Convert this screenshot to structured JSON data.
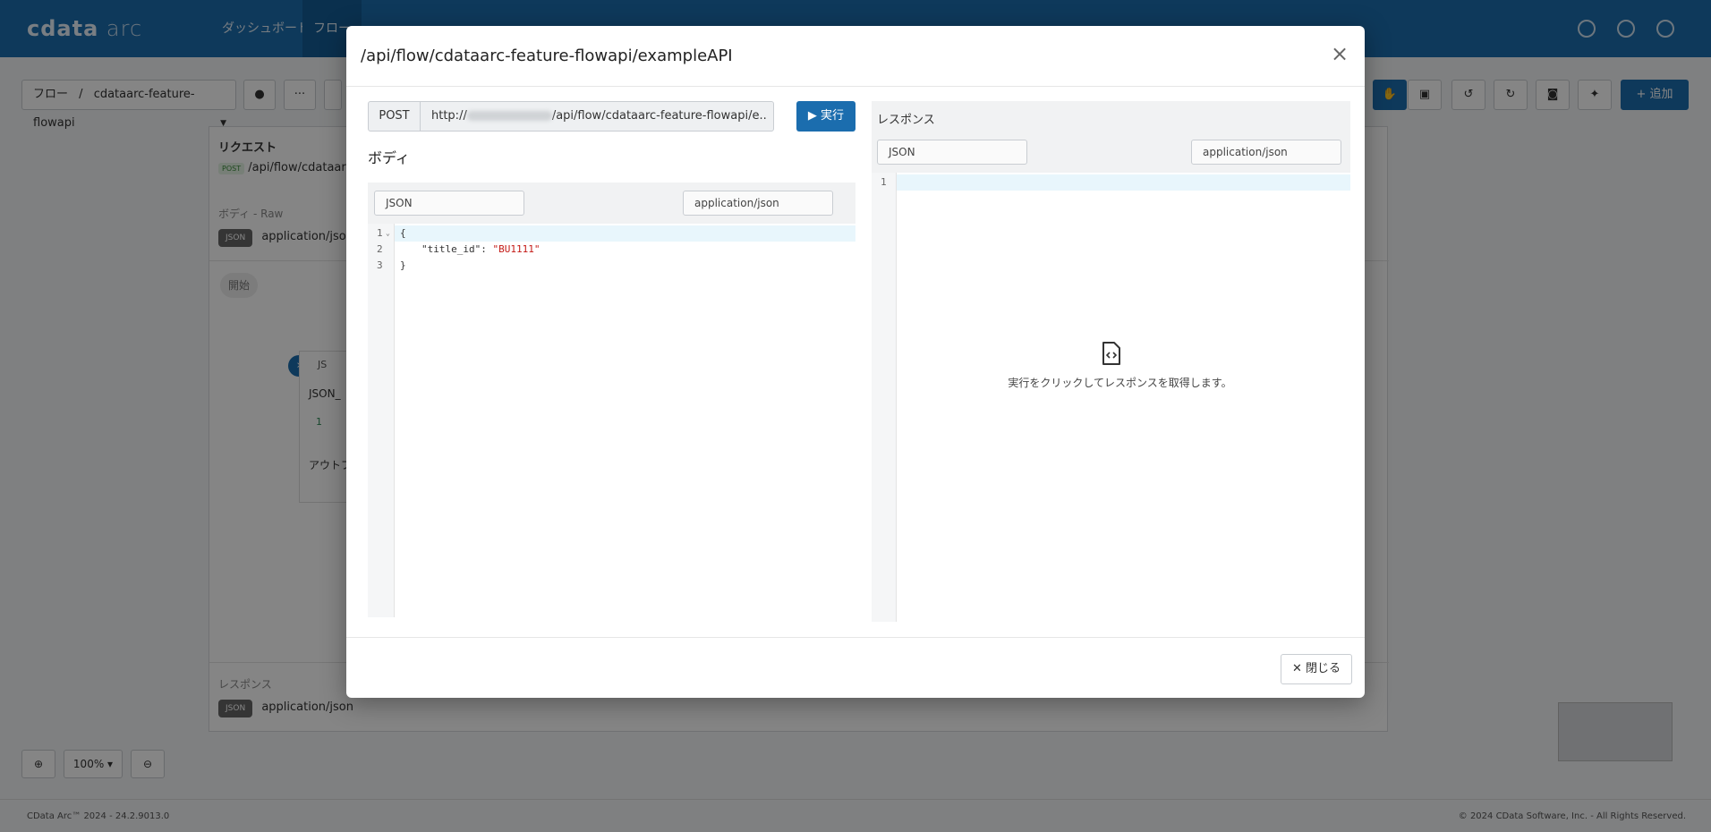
{
  "app": {
    "logo_primary": "cdata",
    "logo_secondary": "arc",
    "nav": [
      {
        "label": "ダッシュボード"
      },
      {
        "label": "フロー"
      }
    ]
  },
  "toolbar": {
    "breadcrumb_root": "フロー",
    "breadcrumb_sep": "/",
    "breadcrumb_current": "cdataarc-feature-flowapi",
    "more_label": "···",
    "add_label": "+ 追加"
  },
  "background": {
    "request_label": "リクエスト",
    "request_method": "POST",
    "request_path": "/api/flow/cdataarc",
    "body_label": "ボディ - Raw",
    "body_format": "JSON",
    "body_content_type": "application/json",
    "start_node": "開始",
    "node_prefix": "JS",
    "node_name": "JSON_",
    "node_count": "1",
    "output_label": "アウトプ",
    "response_label": "レスポンス",
    "response_format": "JSON",
    "response_content_type": "application/json",
    "zoom": "100%"
  },
  "modal": {
    "title": "/api/flow/cdataarc-feature-flowapi/exampleAPI",
    "method": "POST",
    "url_prefix": "http://",
    "url_suffix": "/api/flow/cdataarc-feature-flowapi/e...",
    "run_label": "▶ 実行",
    "body_title": "ボディ",
    "body_format": "JSON",
    "body_content_type": "application/json",
    "code_lines": [
      {
        "num": "1",
        "text": "{"
      },
      {
        "num": "2",
        "key": "\"title_id\"",
        "sep": ": ",
        "value": "\"BU1111\""
      },
      {
        "num": "3",
        "text": "}"
      }
    ],
    "response_title": "レスポンス",
    "response_format": "JSON",
    "response_content_type": "application/json",
    "response_line_num": "1",
    "empty_message": "実行をクリックしてレスポンスを取得します。",
    "close_label": "✕ 閉じる"
  },
  "footer": {
    "left": "CData Arc™ 2024 - 24.2.9013.0",
    "right": "© 2024 CData Software, Inc. - All Rights Reserved."
  },
  "colors": {
    "brand": "#1b6dae",
    "string": "#c41a16"
  }
}
